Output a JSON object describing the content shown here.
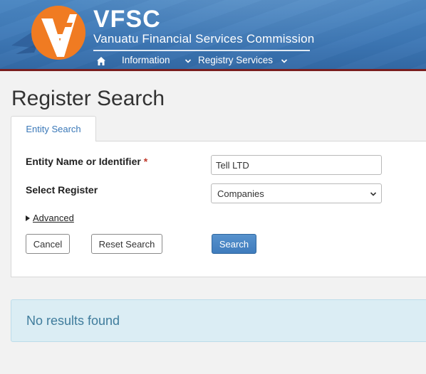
{
  "header": {
    "brand_title": "VFSC",
    "brand_subtitle": "Vanuatu Financial Services Commission",
    "nav": {
      "home_icon": "home-icon",
      "items": [
        {
          "label": "Information",
          "icon": "chevron-down-icon"
        },
        {
          "label": "Registry Services",
          "icon": "chevron-down-icon"
        }
      ]
    },
    "colors": {
      "bar": "#3d77b5",
      "border_accent": "#7a1e1e",
      "logo_orange": "#f07b22"
    }
  },
  "page": {
    "title": "Register Search",
    "tabs": [
      {
        "label": "Entity Search",
        "active": true
      }
    ]
  },
  "form": {
    "entity_label": "Entity Name or Identifier",
    "required_marker": "*",
    "entity_value": "Tell LTD",
    "register_label": "Select Register",
    "register_selected": "Companies",
    "advanced_label": "Advanced",
    "buttons": {
      "cancel": "Cancel",
      "reset": "Reset Search",
      "search": "Search"
    }
  },
  "results": {
    "message": "No results found"
  }
}
